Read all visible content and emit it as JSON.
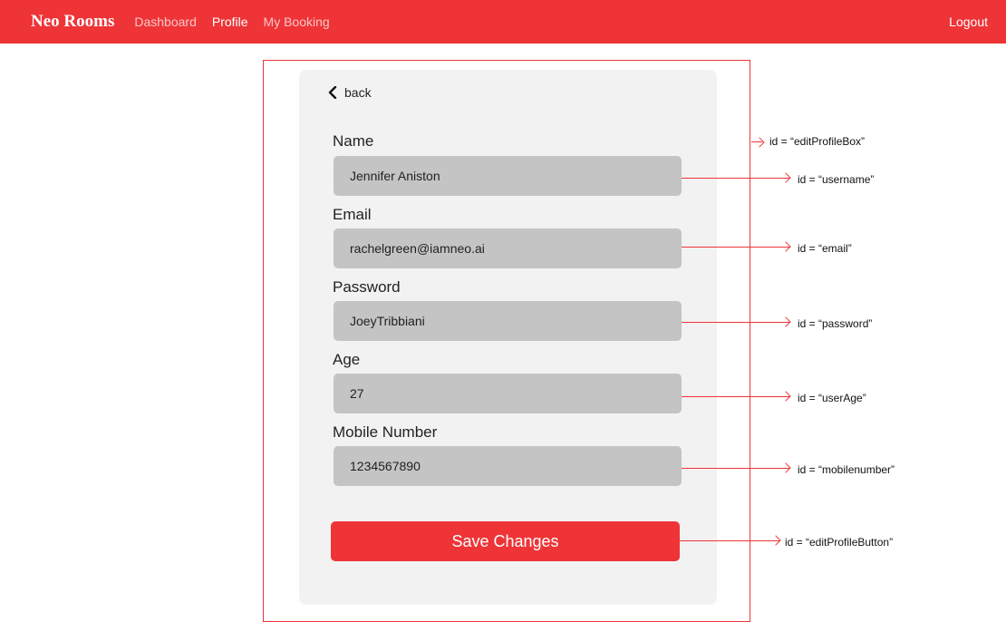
{
  "navbar": {
    "brand": "Neo Rooms",
    "links": [
      "Dashboard",
      "Profile",
      "My Booking"
    ],
    "logout": "Logout"
  },
  "form": {
    "back": "back",
    "fields": [
      {
        "label": "Name",
        "value": "Jennifer Aniston"
      },
      {
        "label": "Email",
        "value": "rachelgreen@iamneo.ai"
      },
      {
        "label": "Password",
        "value": "JoeyTribbiani"
      },
      {
        "label": "Age",
        "value": "27"
      },
      {
        "label": "Mobile Number",
        "value": "1234567890"
      }
    ],
    "save": "Save Changes"
  },
  "annotations": {
    "box": "id = “editProfileBox”",
    "username": "id = “username”",
    "email": "id = “email”",
    "password": "id = “password”",
    "age": "id = “userAge”",
    "mobile": "id = “mobilenumber”",
    "button": "id = “editProfileButton”"
  },
  "colors": {
    "accent": "#ee3437",
    "card": "#f2f2f2",
    "input": "#c4c4c4"
  }
}
